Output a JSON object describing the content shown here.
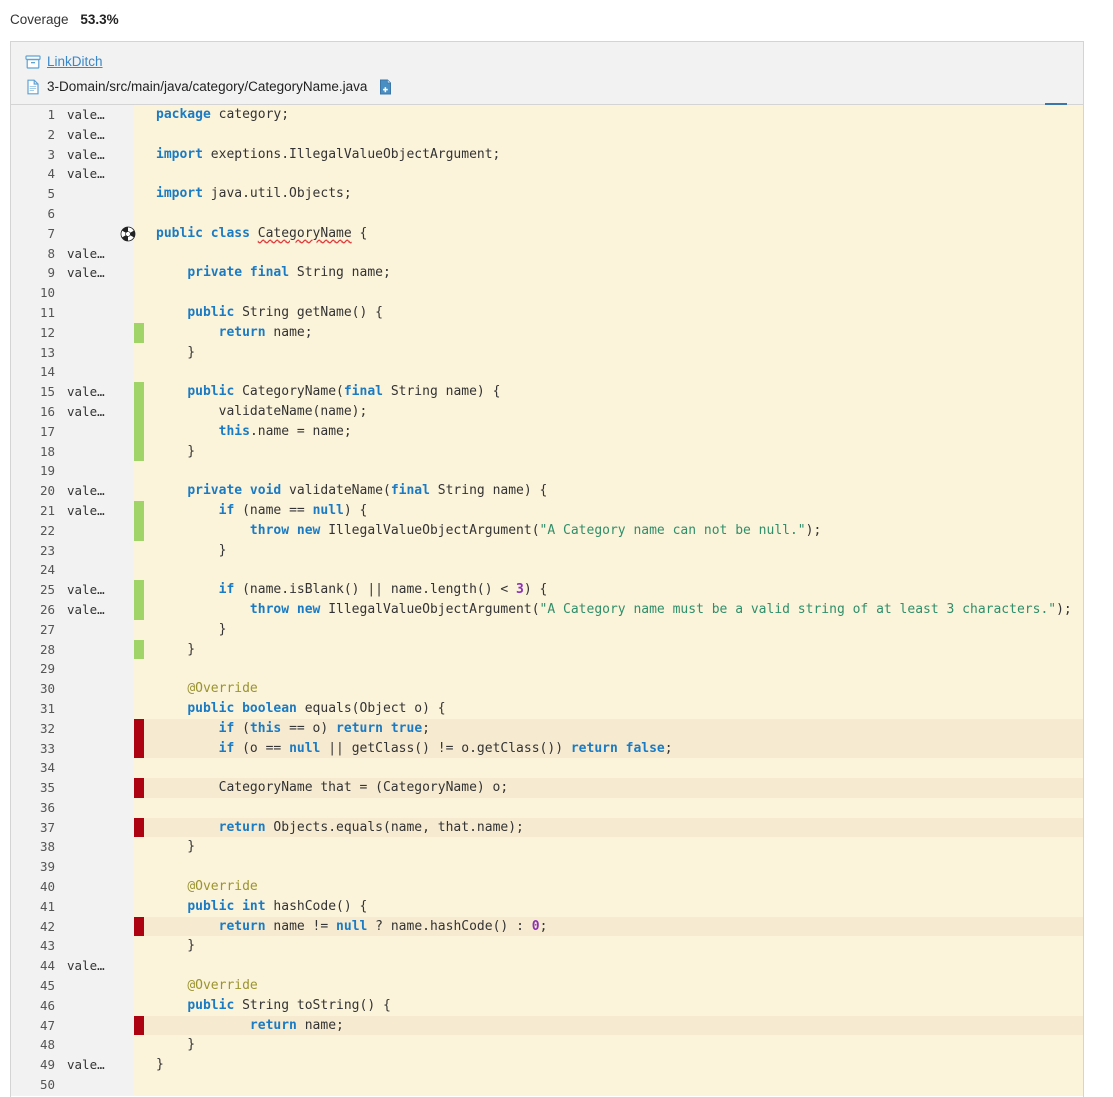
{
  "coverage": {
    "label": "Coverage",
    "value": "53.3%"
  },
  "file_header": {
    "repo_icon": "archive-box-icon",
    "repo_name": "LinkDitch",
    "file_icon": "file-icon",
    "file_path": "3-Domain/src/main/java/category/CategoryName.java",
    "copy_icon": "copy-file-icon",
    "menu_icon": "hamburger-menu-icon"
  },
  "colors": {
    "keyword": "#1a7bc4",
    "string": "#2f8f6a",
    "number": "#8b2fb5",
    "annotation": "#9a9430",
    "covered": "#a0d468",
    "uncovered": "#ad0212",
    "line_bg": "#fbf3da",
    "uncovered_bg": "#f6ead0",
    "link": "#3a87c8"
  },
  "code_lines": [
    {
      "n": "1",
      "blame": "vale…",
      "cov": "",
      "hl": false,
      "mut": false,
      "tokens": [
        {
          "t": "package",
          "c": "kw"
        },
        {
          "t": " category;",
          "c": "pl"
        }
      ]
    },
    {
      "n": "2",
      "blame": "vale…",
      "cov": "",
      "hl": false,
      "mut": false,
      "tokens": []
    },
    {
      "n": "3",
      "blame": "vale…",
      "cov": "",
      "hl": false,
      "mut": false,
      "tokens": [
        {
          "t": "import",
          "c": "kw"
        },
        {
          "t": " exeptions.IllegalValueObjectArgument;",
          "c": "pl"
        }
      ]
    },
    {
      "n": "4",
      "blame": "vale…",
      "cov": "",
      "hl": false,
      "mut": false,
      "tokens": []
    },
    {
      "n": "5",
      "blame": "",
      "cov": "",
      "hl": false,
      "mut": false,
      "tokens": [
        {
          "t": "import",
          "c": "kw"
        },
        {
          "t": " java.util.Objects;",
          "c": "pl"
        }
      ]
    },
    {
      "n": "6",
      "blame": "",
      "cov": "",
      "hl": false,
      "mut": false,
      "tokens": []
    },
    {
      "n": "7",
      "blame": "",
      "cov": "",
      "hl": false,
      "mut": true,
      "tokens": [
        {
          "t": "public class",
          "c": "kw"
        },
        {
          "t": " ",
          "c": "pl"
        },
        {
          "t": "CategoryName",
          "c": "typo"
        },
        {
          "t": " {",
          "c": "pl"
        }
      ]
    },
    {
      "n": "8",
      "blame": "vale…",
      "cov": "",
      "hl": false,
      "mut": false,
      "tokens": []
    },
    {
      "n": "9",
      "blame": "vale…",
      "cov": "",
      "hl": false,
      "mut": false,
      "tokens": [
        {
          "t": "    ",
          "c": "pl"
        },
        {
          "t": "private final",
          "c": "kw"
        },
        {
          "t": " String name;",
          "c": "pl"
        }
      ]
    },
    {
      "n": "10",
      "blame": "",
      "cov": "",
      "hl": false,
      "mut": false,
      "tokens": []
    },
    {
      "n": "11",
      "blame": "",
      "cov": "",
      "hl": false,
      "mut": false,
      "tokens": [
        {
          "t": "    ",
          "c": "pl"
        },
        {
          "t": "public",
          "c": "kw"
        },
        {
          "t": " String getName() {",
          "c": "pl"
        }
      ]
    },
    {
      "n": "12",
      "blame": "",
      "cov": "green",
      "hl": false,
      "mut": false,
      "tokens": [
        {
          "t": "        ",
          "c": "pl"
        },
        {
          "t": "return",
          "c": "kw"
        },
        {
          "t": " name;",
          "c": "pl"
        }
      ]
    },
    {
      "n": "13",
      "blame": "",
      "cov": "",
      "hl": false,
      "mut": false,
      "tokens": [
        {
          "t": "    }",
          "c": "pl"
        }
      ]
    },
    {
      "n": "14",
      "blame": "",
      "cov": "",
      "hl": false,
      "mut": false,
      "tokens": []
    },
    {
      "n": "15",
      "blame": "vale…",
      "cov": "green",
      "hl": false,
      "mut": false,
      "tokens": [
        {
          "t": "    ",
          "c": "pl"
        },
        {
          "t": "public",
          "c": "kw"
        },
        {
          "t": " CategoryName(",
          "c": "pl"
        },
        {
          "t": "final",
          "c": "kw"
        },
        {
          "t": " String name) {",
          "c": "pl"
        }
      ]
    },
    {
      "n": "16",
      "blame": "vale…",
      "cov": "green",
      "hl": false,
      "mut": false,
      "tokens": [
        {
          "t": "        validateName(name);",
          "c": "pl"
        }
      ]
    },
    {
      "n": "17",
      "blame": "",
      "cov": "green",
      "hl": false,
      "mut": false,
      "tokens": [
        {
          "t": "        ",
          "c": "pl"
        },
        {
          "t": "this",
          "c": "kw"
        },
        {
          "t": ".name = name;",
          "c": "pl"
        }
      ]
    },
    {
      "n": "18",
      "blame": "",
      "cov": "green",
      "hl": false,
      "mut": false,
      "tokens": [
        {
          "t": "    }",
          "c": "pl"
        }
      ]
    },
    {
      "n": "19",
      "blame": "",
      "cov": "",
      "hl": false,
      "mut": false,
      "tokens": []
    },
    {
      "n": "20",
      "blame": "vale…",
      "cov": "",
      "hl": false,
      "mut": false,
      "tokens": [
        {
          "t": "    ",
          "c": "pl"
        },
        {
          "t": "private void",
          "c": "kw"
        },
        {
          "t": " validateName(",
          "c": "pl"
        },
        {
          "t": "final",
          "c": "kw"
        },
        {
          "t": " String name) {",
          "c": "pl"
        }
      ]
    },
    {
      "n": "21",
      "blame": "vale…",
      "cov": "green",
      "hl": false,
      "mut": false,
      "tokens": [
        {
          "t": "        ",
          "c": "pl"
        },
        {
          "t": "if",
          "c": "kw"
        },
        {
          "t": " (name == ",
          "c": "pl"
        },
        {
          "t": "null",
          "c": "kw"
        },
        {
          "t": ") {",
          "c": "pl"
        }
      ]
    },
    {
      "n": "22",
      "blame": "",
      "cov": "green",
      "hl": false,
      "mut": false,
      "tokens": [
        {
          "t": "            ",
          "c": "pl"
        },
        {
          "t": "throw new",
          "c": "kw"
        },
        {
          "t": " IllegalValueObjectArgument(",
          "c": "pl"
        },
        {
          "t": "\"A Category name can not be null.\"",
          "c": "str"
        },
        {
          "t": ");",
          "c": "pl"
        }
      ]
    },
    {
      "n": "23",
      "blame": "",
      "cov": "",
      "hl": false,
      "mut": false,
      "tokens": [
        {
          "t": "        }",
          "c": "pl"
        }
      ]
    },
    {
      "n": "24",
      "blame": "",
      "cov": "",
      "hl": false,
      "mut": false,
      "tokens": []
    },
    {
      "n": "25",
      "blame": "vale…",
      "cov": "green",
      "hl": false,
      "mut": false,
      "tokens": [
        {
          "t": "        ",
          "c": "pl"
        },
        {
          "t": "if",
          "c": "kw"
        },
        {
          "t": " (name.isBlank() || name.length() < ",
          "c": "pl"
        },
        {
          "t": "3",
          "c": "num"
        },
        {
          "t": ") {",
          "c": "pl"
        }
      ]
    },
    {
      "n": "26",
      "blame": "vale…",
      "cov": "green",
      "hl": false,
      "mut": false,
      "tokens": [
        {
          "t": "            ",
          "c": "pl"
        },
        {
          "t": "throw new",
          "c": "kw"
        },
        {
          "t": " IllegalValueObjectArgument(",
          "c": "pl"
        },
        {
          "t": "\"A Category name must be a valid string of at least 3 characters.\"",
          "c": "str"
        },
        {
          "t": ");",
          "c": "pl"
        }
      ]
    },
    {
      "n": "27",
      "blame": "",
      "cov": "",
      "hl": false,
      "mut": false,
      "tokens": [
        {
          "t": "        }",
          "c": "pl"
        }
      ]
    },
    {
      "n": "28",
      "blame": "",
      "cov": "green",
      "hl": false,
      "mut": false,
      "tokens": [
        {
          "t": "    }",
          "c": "pl"
        }
      ]
    },
    {
      "n": "29",
      "blame": "",
      "cov": "",
      "hl": false,
      "mut": false,
      "tokens": []
    },
    {
      "n": "30",
      "blame": "",
      "cov": "",
      "hl": false,
      "mut": false,
      "tokens": [
        {
          "t": "    ",
          "c": "pl"
        },
        {
          "t": "@Override",
          "c": "ann"
        }
      ]
    },
    {
      "n": "31",
      "blame": "",
      "cov": "",
      "hl": false,
      "mut": false,
      "tokens": [
        {
          "t": "    ",
          "c": "pl"
        },
        {
          "t": "public boolean",
          "c": "kw"
        },
        {
          "t": " equals(Object o) {",
          "c": "pl"
        }
      ]
    },
    {
      "n": "32",
      "blame": "",
      "cov": "red",
      "hl": true,
      "mut": false,
      "tokens": [
        {
          "t": "        ",
          "c": "pl"
        },
        {
          "t": "if",
          "c": "kw"
        },
        {
          "t": " (",
          "c": "pl"
        },
        {
          "t": "this",
          "c": "kw"
        },
        {
          "t": " == o) ",
          "c": "pl"
        },
        {
          "t": "return true",
          "c": "kw"
        },
        {
          "t": ";",
          "c": "pl"
        }
      ]
    },
    {
      "n": "33",
      "blame": "",
      "cov": "red",
      "hl": true,
      "mut": false,
      "tokens": [
        {
          "t": "        ",
          "c": "pl"
        },
        {
          "t": "if",
          "c": "kw"
        },
        {
          "t": " (o == ",
          "c": "pl"
        },
        {
          "t": "null",
          "c": "kw"
        },
        {
          "t": " || getClass() != o.getClass()) ",
          "c": "pl"
        },
        {
          "t": "return false",
          "c": "kw"
        },
        {
          "t": ";",
          "c": "pl"
        }
      ]
    },
    {
      "n": "34",
      "blame": "",
      "cov": "",
      "hl": false,
      "mut": false,
      "tokens": []
    },
    {
      "n": "35",
      "blame": "",
      "cov": "red",
      "hl": true,
      "mut": false,
      "tokens": [
        {
          "t": "        CategoryName that = (CategoryName) o;",
          "c": "pl"
        }
      ]
    },
    {
      "n": "36",
      "blame": "",
      "cov": "",
      "hl": false,
      "mut": false,
      "tokens": []
    },
    {
      "n": "37",
      "blame": "",
      "cov": "red",
      "hl": true,
      "mut": false,
      "tokens": [
        {
          "t": "        ",
          "c": "pl"
        },
        {
          "t": "return",
          "c": "kw"
        },
        {
          "t": " Objects.equals(name, that.name);",
          "c": "pl"
        }
      ]
    },
    {
      "n": "38",
      "blame": "",
      "cov": "",
      "hl": false,
      "mut": false,
      "tokens": [
        {
          "t": "    }",
          "c": "pl"
        }
      ]
    },
    {
      "n": "39",
      "blame": "",
      "cov": "",
      "hl": false,
      "mut": false,
      "tokens": []
    },
    {
      "n": "40",
      "blame": "",
      "cov": "",
      "hl": false,
      "mut": false,
      "tokens": [
        {
          "t": "    ",
          "c": "pl"
        },
        {
          "t": "@Override",
          "c": "ann"
        }
      ]
    },
    {
      "n": "41",
      "blame": "",
      "cov": "",
      "hl": false,
      "mut": false,
      "tokens": [
        {
          "t": "    ",
          "c": "pl"
        },
        {
          "t": "public int",
          "c": "kw"
        },
        {
          "t": " hashCode() {",
          "c": "pl"
        }
      ]
    },
    {
      "n": "42",
      "blame": "",
      "cov": "red",
      "hl": true,
      "mut": false,
      "tokens": [
        {
          "t": "        ",
          "c": "pl"
        },
        {
          "t": "return",
          "c": "kw"
        },
        {
          "t": " name != ",
          "c": "pl"
        },
        {
          "t": "null",
          "c": "kw"
        },
        {
          "t": " ? name.hashCode() : ",
          "c": "pl"
        },
        {
          "t": "0",
          "c": "num"
        },
        {
          "t": ";",
          "c": "pl"
        }
      ]
    },
    {
      "n": "43",
      "blame": "",
      "cov": "",
      "hl": false,
      "mut": false,
      "tokens": [
        {
          "t": "    }",
          "c": "pl"
        }
      ]
    },
    {
      "n": "44",
      "blame": "vale…",
      "cov": "",
      "hl": false,
      "mut": false,
      "tokens": []
    },
    {
      "n": "45",
      "blame": "",
      "cov": "",
      "hl": false,
      "mut": false,
      "tokens": [
        {
          "t": "    ",
          "c": "pl"
        },
        {
          "t": "@Override",
          "c": "ann"
        }
      ]
    },
    {
      "n": "46",
      "blame": "",
      "cov": "",
      "hl": false,
      "mut": false,
      "tokens": [
        {
          "t": "    ",
          "c": "pl"
        },
        {
          "t": "public",
          "c": "kw"
        },
        {
          "t": " String toString() {",
          "c": "pl"
        }
      ]
    },
    {
      "n": "47",
      "blame": "",
      "cov": "red",
      "hl": true,
      "mut": false,
      "tokens": [
        {
          "t": "            ",
          "c": "pl"
        },
        {
          "t": "return",
          "c": "kw"
        },
        {
          "t": " name;",
          "c": "pl"
        }
      ]
    },
    {
      "n": "48",
      "blame": "",
      "cov": "",
      "hl": false,
      "mut": false,
      "tokens": [
        {
          "t": "    }",
          "c": "pl"
        }
      ]
    },
    {
      "n": "49",
      "blame": "vale…",
      "cov": "",
      "hl": false,
      "mut": false,
      "tokens": [
        {
          "t": "}",
          "c": "pl"
        }
      ]
    },
    {
      "n": "50",
      "blame": "",
      "cov": "",
      "hl": false,
      "mut": false,
      "tokens": []
    }
  ]
}
